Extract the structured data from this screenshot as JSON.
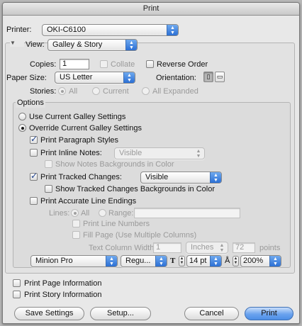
{
  "window": {
    "title": "Print"
  },
  "printer": {
    "label": "Printer:",
    "value": "OKI-C6100"
  },
  "view": {
    "label": "View:",
    "value": "Galley & Story"
  },
  "copies": {
    "label": "Copies:",
    "value": "1",
    "collate_label": "Collate",
    "reverse_label": "Reverse Order"
  },
  "paper": {
    "label": "Paper Size:",
    "value": "US Letter",
    "orientation_label": "Orientation:"
  },
  "stories": {
    "label": "Stories:",
    "all": "All",
    "current": "Current",
    "expanded": "All Expanded"
  },
  "options": {
    "title": "Options",
    "use_current": "Use Current Galley Settings",
    "override": "Override Current Galley Settings",
    "para_styles": "Print Paragraph Styles",
    "inline_notes": "Print Inline Notes:",
    "inline_notes_value": "Visible",
    "notes_bg": "Show Notes Backgrounds in Color",
    "tracked": "Print Tracked Changes:",
    "tracked_value": "Visible",
    "tracked_bg": "Show Tracked Changes Backgrounds in Color",
    "accurate": "Print Accurate Line Endings",
    "lines_label": "Lines:",
    "lines_all": "All",
    "lines_range": "Range:",
    "line_numbers": "Print Line Numbers",
    "fill_page": "Fill Page (Use Multiple Columns)",
    "col_width_label": "Text Column Width:",
    "col_width_value": "1",
    "units": "Inches",
    "points_value": "72",
    "points_label": "points",
    "font": "Minion Pro",
    "style": "Regu...",
    "size": "14 pt",
    "zoom": "200%"
  },
  "page_info": "Print Page Information",
  "story_info": "Print Story Information",
  "buttons": {
    "save": "Save Settings",
    "setup": "Setup...",
    "cancel": "Cancel",
    "print": "Print"
  }
}
